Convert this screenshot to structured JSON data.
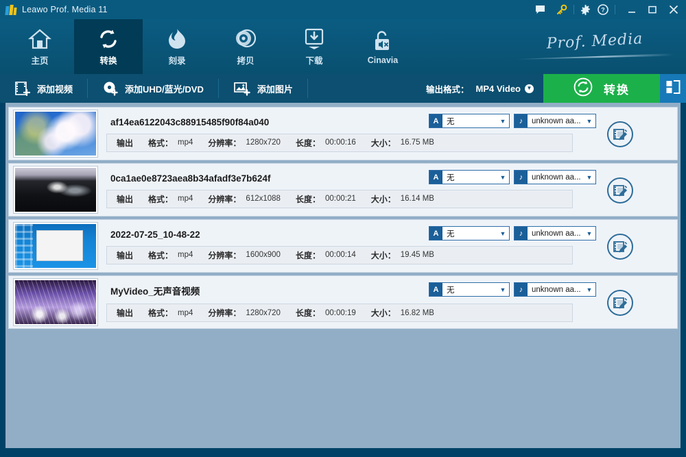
{
  "window": {
    "title": "Leawo Prof. Media 11",
    "logo_icon": "leawo-logo-icon",
    "controls": [
      {
        "name": "feedback-icon",
        "label": ""
      },
      {
        "name": "key-icon",
        "label": ""
      },
      {
        "name": "gear-icon",
        "label": ""
      },
      {
        "name": "help-icon",
        "label": ""
      },
      {
        "name": "minimize-icon",
        "label": ""
      },
      {
        "name": "maximize-icon",
        "label": ""
      },
      {
        "name": "close-icon",
        "label": ""
      }
    ]
  },
  "nav": {
    "items": [
      {
        "label": "主页",
        "icon": "home-icon",
        "active": false
      },
      {
        "label": "转换",
        "icon": "convert-icon",
        "active": true
      },
      {
        "label": "刻录",
        "icon": "burn-icon",
        "active": false
      },
      {
        "label": "拷贝",
        "icon": "copy-icon",
        "active": false
      },
      {
        "label": "下载",
        "icon": "download-icon",
        "active": false
      },
      {
        "label": "Cinavia",
        "icon": "cinavia-icon",
        "active": false
      }
    ],
    "brand_text": "Prof. Media"
  },
  "toolbar": {
    "add_video": "添加视频",
    "add_disc": "添加UHD/蓝光/DVD",
    "add_photo": "添加图片",
    "output_format_label": "输出格式：",
    "output_format_value": "MP4 Video",
    "convert_label": "转换",
    "panel_toggle_icon": "panel-layout-icon",
    "convert_color": "#1cb04a",
    "panel_color": "#1779b8"
  },
  "list": {
    "labels": {
      "output": "输出",
      "format": "格式：",
      "resolution": "分辨率：",
      "duration": "长度：",
      "size": "大小："
    },
    "rows": [
      {
        "name": "af14ea6122043c88915485f90f84a040",
        "format": "mp4",
        "resolution": "1280x720",
        "duration": "00:00:16",
        "size": "16.75 MB",
        "subtitle": "无",
        "subtitle_badge": "A",
        "audio": "unknown aa...",
        "thumb_class": "blossom"
      },
      {
        "name": "0ca1ae0e8723aea8b34afadf3e7b624f",
        "format": "mp4",
        "resolution": "612x1088",
        "duration": "00:00:21",
        "size": "16.14 MB",
        "subtitle": "无",
        "subtitle_badge": "A",
        "audio": "unknown aa...",
        "thumb_class": "night"
      },
      {
        "name": "2022-07-25_10-48-22",
        "format": "mp4",
        "resolution": "1600x900",
        "duration": "00:00:14",
        "size": "19.45 MB",
        "subtitle": "无",
        "subtitle_badge": "A",
        "audio": "unknown aa...",
        "thumb_class": "desktop"
      },
      {
        "name": "MyVideo_无声音视频",
        "format": "mp4",
        "resolution": "1280x720",
        "duration": "00:00:19",
        "size": "16.82 MB",
        "subtitle": "无",
        "subtitle_badge": "A",
        "audio": "unknown aa...",
        "thumb_class": "sparkle"
      }
    ]
  },
  "colors": {
    "titlebar": "#0a5a80",
    "nav": "#0b5c82",
    "nav_active": "#013b56",
    "toolbar": "#0c4f70",
    "content_bg": "#92aec7",
    "window_frame": "#004267",
    "row_bg": "#eef3f8",
    "accent_green": "#1cb04a"
  }
}
